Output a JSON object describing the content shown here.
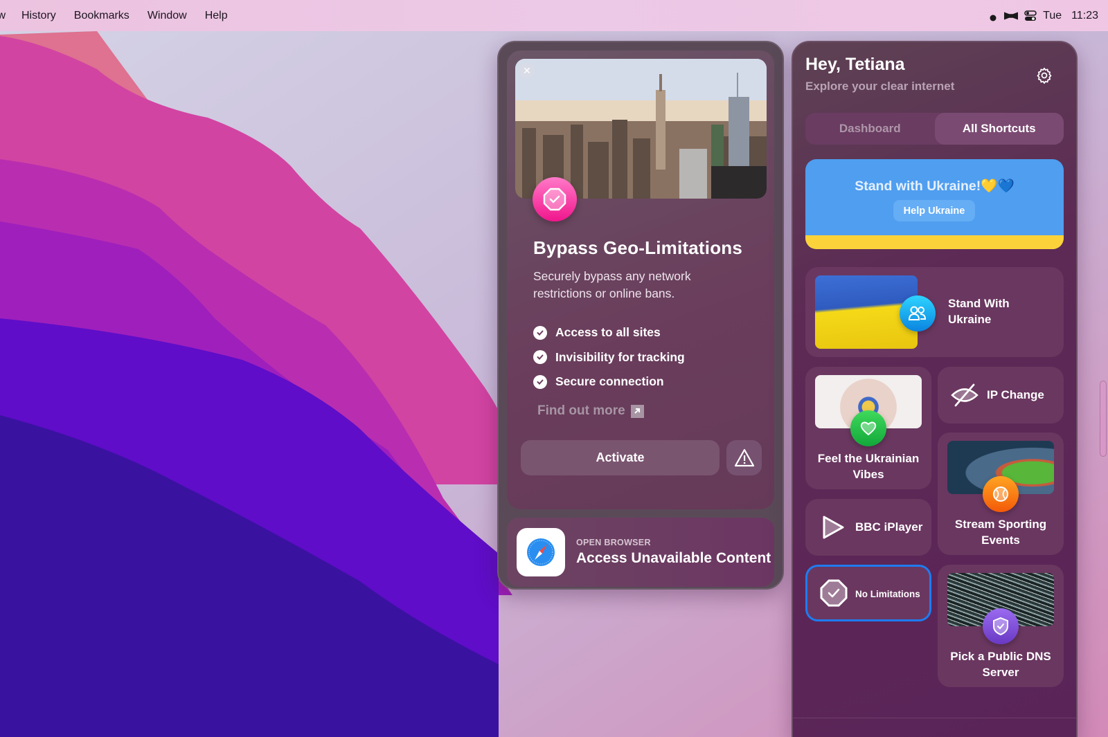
{
  "menubar": {
    "items": [
      "w",
      "History",
      "Bookmarks",
      "Window",
      "Help"
    ],
    "status_icons": [
      "moon-focus-icon",
      "bowtie-app-icon",
      "control-center-icon"
    ],
    "day": "Tue",
    "time": "11:23"
  },
  "feature_card": {
    "close_icon": "close-icon",
    "badge_icon": "octagon-check-icon",
    "title": "Bypass Geo-Limitations",
    "description": "Securely bypass any network restrictions or online bans.",
    "benefits": [
      "Access to all sites",
      "Invisibility for tracking",
      "Secure connection"
    ],
    "find_more": "Find out more",
    "activate": "Activate",
    "warning_icon": "warning-triangle-icon"
  },
  "browser_card": {
    "eyebrow": "OPEN BROWSER",
    "title": "Access Unavailable Content",
    "icon": "safari-compass-icon"
  },
  "panel": {
    "greeting": "Hey, Tetiana",
    "subtitle": "Explore your clear internet",
    "tabs": [
      {
        "label": "Dashboard",
        "active": false
      },
      {
        "label": "All Shortcuts",
        "active": true
      }
    ],
    "banner": {
      "title": "Stand with Ukraine!💛💙",
      "button": "Help Ukraine",
      "colors": {
        "blue": "#4f9ef0",
        "yellow": "#fcd23a"
      }
    },
    "shortcuts": [
      {
        "label": "Stand With Ukraine",
        "line1": "Stand With",
        "line2": "Ukraine",
        "icon": "people-icon"
      },
      {
        "label": "Feel the Ukrainian Vibes",
        "line1": "Feel the Ukrainian",
        "line2": "Vibes",
        "icon": "heart-icon"
      },
      {
        "label": "IP Change",
        "icon": "eye-slash-icon"
      },
      {
        "label": "Stream Sporting Events",
        "line1": "Stream Sporting",
        "line2": "Events",
        "icon": "ball-icon"
      },
      {
        "label": "BBC iPlayer",
        "icon": "play-icon"
      },
      {
        "label": "No Limitations",
        "icon": "octagon-check-icon",
        "selected": true
      },
      {
        "label": "Pick a Public DNS Server",
        "line1": "Pick a Public DNS",
        "line2": "Server",
        "icon": "shield-check-icon"
      }
    ]
  }
}
